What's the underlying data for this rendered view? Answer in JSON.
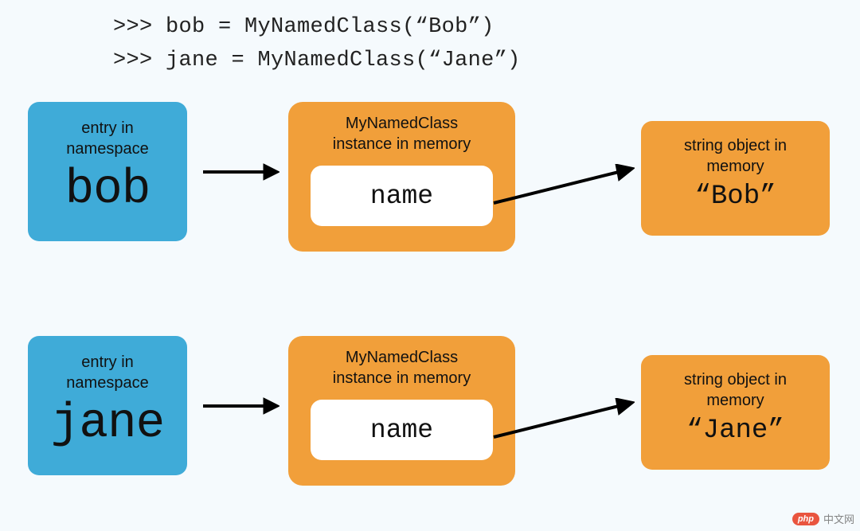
{
  "code": {
    "line1": ">>> bob = MyNamedClass(“Bob”)",
    "line2": ">>> jane = MyNamedClass(“Jane”)"
  },
  "rows": [
    {
      "namespace": {
        "label_l1": "entry in",
        "label_l2": "namespace",
        "var": "bob"
      },
      "instance": {
        "label_l1": "MyNamedClass",
        "label_l2": "instance in memory",
        "attr": "name"
      },
      "string": {
        "label_l1": "string object in",
        "label_l2": "memory",
        "value": "“Bob”"
      }
    },
    {
      "namespace": {
        "label_l1": "entry in",
        "label_l2": "namespace",
        "var": "jane"
      },
      "instance": {
        "label_l1": "MyNamedClass",
        "label_l2": "instance in memory",
        "attr": "name"
      },
      "string": {
        "label_l1": "string object in",
        "label_l2": "memory",
        "value": "“Jane”"
      }
    }
  ],
  "watermark": {
    "pill": "php",
    "text": "中文网"
  },
  "colors": {
    "bg": "#f5fafd",
    "blue": "#3fabd8",
    "orange": "#f19f3a"
  }
}
